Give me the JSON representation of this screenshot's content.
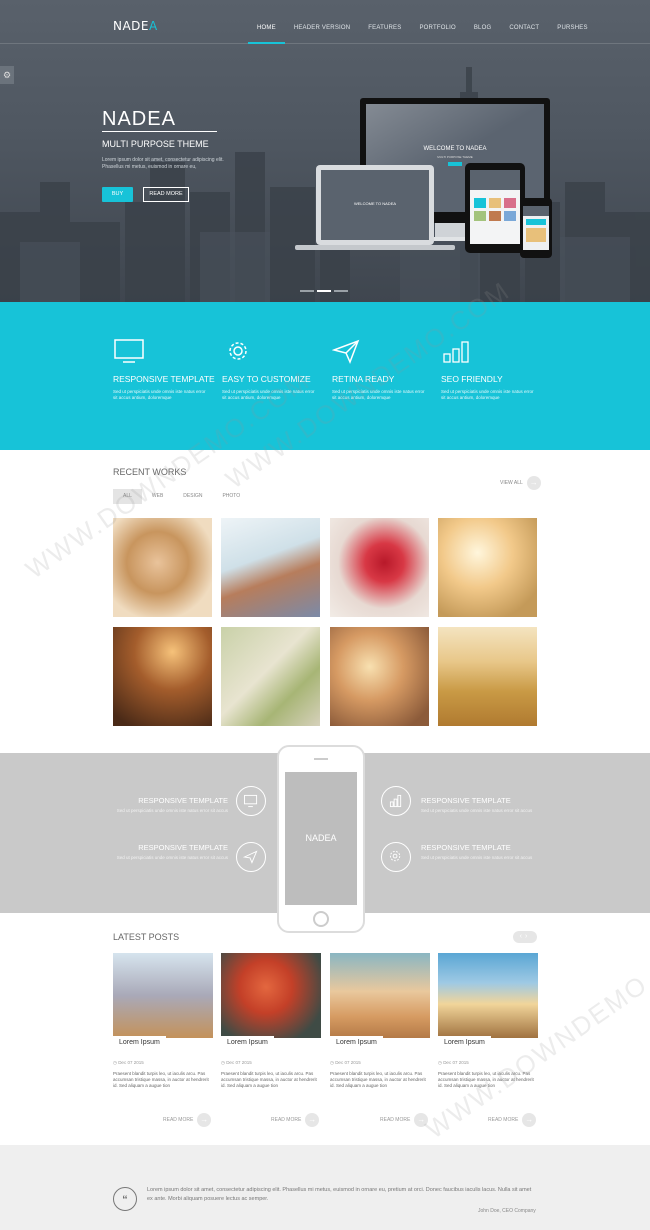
{
  "brand": {
    "name": "NADE",
    "accent": "A",
    "accent_color": "#17c3d8"
  },
  "nav": [
    "HOME",
    "HEADER VERSION",
    "FEATURES",
    "PORTFOLIO",
    "BLOG",
    "CONTACT",
    "PURSHES"
  ],
  "hero": {
    "title": "NADEA",
    "subtitle": "MULTI PURPOSE THEME",
    "text": "Lorem ipsum dolor sit amet, consectetur adipiscing elit. Phasellus mi metus, euismod in ornare eu,",
    "buy": "BUY",
    "more": "READ MORE",
    "device_label": "WELCOME TO NADEA",
    "device_sub": "MULTI PURPOSE THEME",
    "small_label": "WELCOME TO NADEA"
  },
  "features": [
    {
      "icon": "monitor-icon",
      "title": "RESPONSIVE TEMPLATE",
      "text": "Sed ut perspiciatis unde omnis iste natus error sit accus antium, doloremque"
    },
    {
      "icon": "gear-icon",
      "title": "EASY TO CUSTOMIZE",
      "text": "Sed ut perspiciatis unde omnis iste natus error sit accus antium, doloremque"
    },
    {
      "icon": "paper-plane-icon",
      "title": "RETINA READY",
      "text": "Sed ut perspiciatis unde omnis iste natus error sit accus antium, doloremque"
    },
    {
      "icon": "bar-chart-icon",
      "title": "SEO FRIENDLY",
      "text": "Sed ut perspiciatis unde omnis iste natus error sit accus antium, doloremque"
    }
  ],
  "works": {
    "title": "RECENT WORKS",
    "filters": [
      "ALL",
      "WEB",
      "DESIGN",
      "PHOTO"
    ],
    "view_all": "VIEW ALL"
  },
  "app": {
    "phone_label": "NADEA",
    "left": [
      {
        "title": "RESPONSIVE TEMPLATE",
        "text": "Sed ut perspiciatis unde omnis iste natus error sit accus"
      },
      {
        "title": "RESPONSIVE TEMPLATE",
        "text": "Sed ut perspiciatis unde omnis iste natus error sit accus"
      }
    ],
    "right": [
      {
        "title": "RESPONSIVE TEMPLATE",
        "text": "Sed ut perspiciatis unde omnis iste natus error sit accus"
      },
      {
        "title": "RESPONSIVE TEMPLATE",
        "text": "Sed ut perspiciatis unde omnis iste natus error sit accus"
      }
    ]
  },
  "posts": {
    "title": "LATEST POSTS",
    "items": [
      {
        "label": "Lorem Ipsum",
        "date": "Dec 07 2015",
        "text": "Praesent blandit turpis leo, ut iaculis arcu. Pas accumsan tristique massa, in auctor at hendrerit id. Sed aliquam a augue tion",
        "more": "READ MORE"
      },
      {
        "label": "Lorem Ipsum",
        "date": "Dec 07 2015",
        "text": "Praesent blandit turpis leo, ut iaculis arcu. Pas accumsan tristique massa, in auctor at hendrerit id. Sed aliquam a augue tion",
        "more": "READ MORE"
      },
      {
        "label": "Lorem Ipsum",
        "date": "Dec 07 2015",
        "text": "Praesent blandit turpis leo, ut iaculis arcu. Pas accumsan tristique massa, in auctor at hendrerit id. Sed aliquam a augue tion",
        "more": "READ MORE"
      },
      {
        "label": "Lorem Ipsum",
        "date": "Dec 07 2015",
        "text": "Praesent blandit turpis leo, ut iaculis arcu. Pas accumsan tristique massa, in auctor at hendrerit id. Sed aliquam a augue tion",
        "more": "READ MORE"
      }
    ]
  },
  "testimonial": {
    "text": "Lorem ipsum dolor sit amet, consectetur adipiscing elit. Phasellus mi metus, euismod in ornare eu, pretium at orci. Donec faucibus iaculis lacus. Nulla sit amet ex ante. Morbi aliquam posuere lectus ac semper.",
    "author": "John Doe, CEO Company"
  },
  "watermark": "WWW.DOWNDEMO.COM"
}
